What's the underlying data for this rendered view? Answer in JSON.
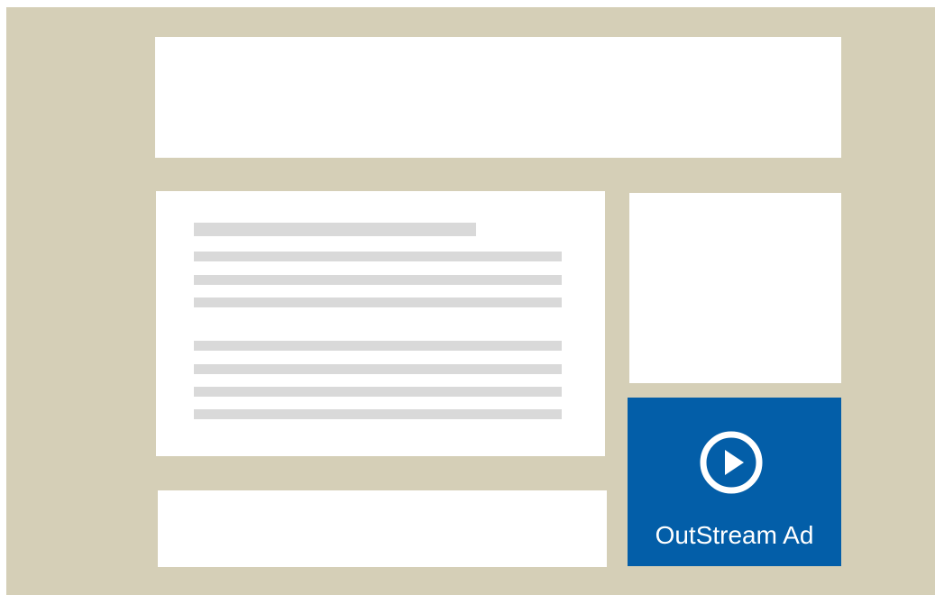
{
  "ad": {
    "label": "OutStream Ad",
    "icon": "play-circle-icon",
    "background_color": "#035ea8",
    "text_color": "#ffffff"
  },
  "page_background_color": "#d5cfb7",
  "placeholder_block_color": "#ffffff",
  "text_placeholder_color": "#d9d9d9"
}
